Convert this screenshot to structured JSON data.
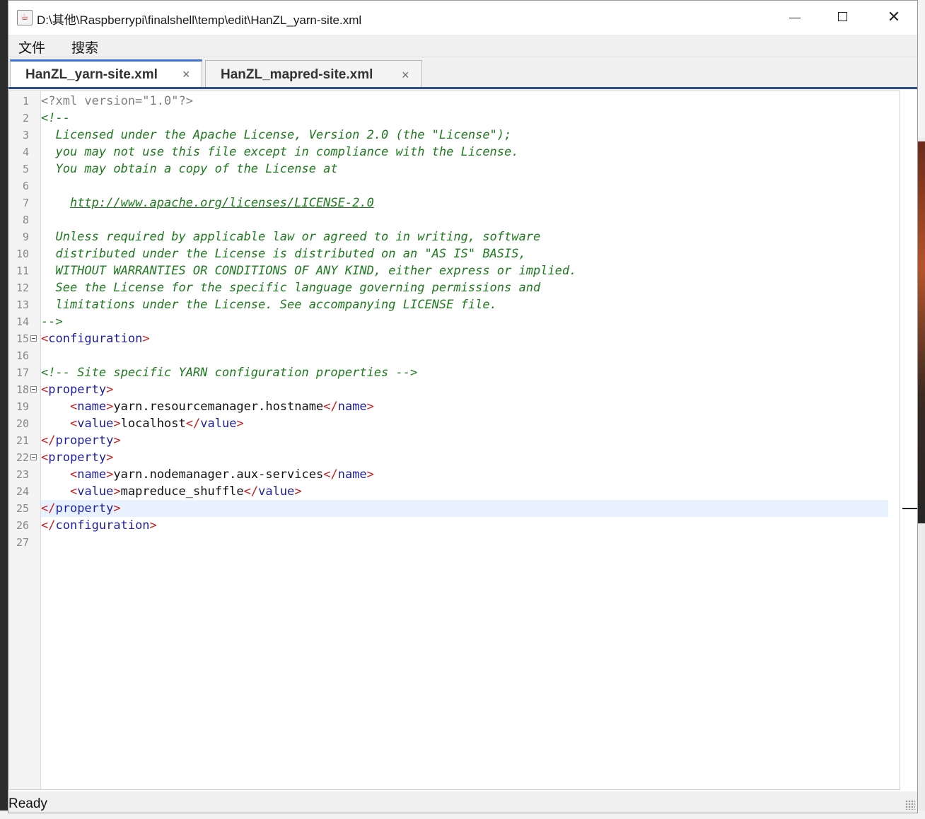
{
  "window": {
    "title": "D:\\其他\\Raspberrypi\\finalshell\\temp\\edit\\HanZL_yarn-site.xml",
    "app_icon": "java-cup-icon"
  },
  "menu": {
    "items": [
      "文件",
      "搜索"
    ]
  },
  "tabs": [
    {
      "label": "HanZL_yarn-site.xml",
      "active": true,
      "close": "×"
    },
    {
      "label": "HanZL_mapred-site.xml",
      "active": false,
      "close": "×"
    }
  ],
  "editor": {
    "current_line": 25,
    "fold_lines": [
      15,
      18,
      22
    ],
    "lines": [
      [
        [
          "pi",
          "<?xml version=\"1.0\"?>"
        ]
      ],
      [
        [
          "comment",
          "<!--"
        ]
      ],
      [
        [
          "comment",
          "  Licensed under the Apache License, Version 2.0 (the \"License\");"
        ]
      ],
      [
        [
          "comment",
          "  you may not use this file except in compliance with the License."
        ]
      ],
      [
        [
          "comment",
          "  You may obtain a copy of the License at"
        ]
      ],
      [
        [
          "comment",
          ""
        ]
      ],
      [
        [
          "comment",
          "    "
        ],
        [
          "link",
          "http://www.apache.org/licenses/LICENSE-2.0"
        ]
      ],
      [
        [
          "comment",
          ""
        ]
      ],
      [
        [
          "comment",
          "  Unless required by applicable law or agreed to in writing, software"
        ]
      ],
      [
        [
          "comment",
          "  distributed under the License is distributed on an \"AS IS\" BASIS,"
        ]
      ],
      [
        [
          "comment",
          "  WITHOUT WARRANTIES OR CONDITIONS OF ANY KIND, either express or implied."
        ]
      ],
      [
        [
          "comment",
          "  See the License for the specific language governing permissions and"
        ]
      ],
      [
        [
          "comment",
          "  limitations under the License. See accompanying LICENSE file."
        ]
      ],
      [
        [
          "comment",
          "-->"
        ]
      ],
      [
        [
          "br",
          "<"
        ],
        [
          "tag",
          "configuration"
        ],
        [
          "br",
          ">"
        ]
      ],
      [
        [
          "text",
          ""
        ]
      ],
      [
        [
          "comment",
          "<!-- Site specific YARN configuration properties -->"
        ]
      ],
      [
        [
          "br",
          "<"
        ],
        [
          "tag",
          "property"
        ],
        [
          "br",
          ">"
        ]
      ],
      [
        [
          "text",
          "    "
        ],
        [
          "br",
          "<"
        ],
        [
          "tag",
          "name"
        ],
        [
          "br",
          ">"
        ],
        [
          "text",
          "yarn.resourcemanager.hostname"
        ],
        [
          "br",
          "</"
        ],
        [
          "tag",
          "name"
        ],
        [
          "br",
          ">"
        ]
      ],
      [
        [
          "text",
          "    "
        ],
        [
          "br",
          "<"
        ],
        [
          "tag",
          "value"
        ],
        [
          "br",
          ">"
        ],
        [
          "text",
          "localhost"
        ],
        [
          "br",
          "</"
        ],
        [
          "tag",
          "value"
        ],
        [
          "br",
          ">"
        ]
      ],
      [
        [
          "br",
          "</"
        ],
        [
          "tag",
          "property"
        ],
        [
          "br",
          ">"
        ]
      ],
      [
        [
          "br",
          "<"
        ],
        [
          "tag",
          "property"
        ],
        [
          "br",
          ">"
        ]
      ],
      [
        [
          "text",
          "    "
        ],
        [
          "br",
          "<"
        ],
        [
          "tag",
          "name"
        ],
        [
          "br",
          ">"
        ],
        [
          "text",
          "yarn.nodemanager.aux-services"
        ],
        [
          "br",
          "</"
        ],
        [
          "tag",
          "name"
        ],
        [
          "br",
          ">"
        ]
      ],
      [
        [
          "text",
          "    "
        ],
        [
          "br",
          "<"
        ],
        [
          "tag",
          "value"
        ],
        [
          "br",
          ">"
        ],
        [
          "text",
          "mapreduce_shuffle"
        ],
        [
          "br",
          "</"
        ],
        [
          "tag",
          "value"
        ],
        [
          "br",
          ">"
        ]
      ],
      [
        [
          "br",
          "</"
        ],
        [
          "tag",
          "property"
        ],
        [
          "br",
          ">"
        ]
      ],
      [
        [
          "br",
          "</"
        ],
        [
          "tag",
          "configuration"
        ],
        [
          "br",
          ">"
        ]
      ],
      [
        [
          "text",
          ""
        ]
      ]
    ]
  },
  "status": {
    "text": "Ready"
  },
  "colors": {
    "tab_accent": "#3b6fd6",
    "comment": "#1f7a1f",
    "bracket": "#c81e1e",
    "tag": "#1e1e9e",
    "current_line": "#e8f2fe"
  }
}
